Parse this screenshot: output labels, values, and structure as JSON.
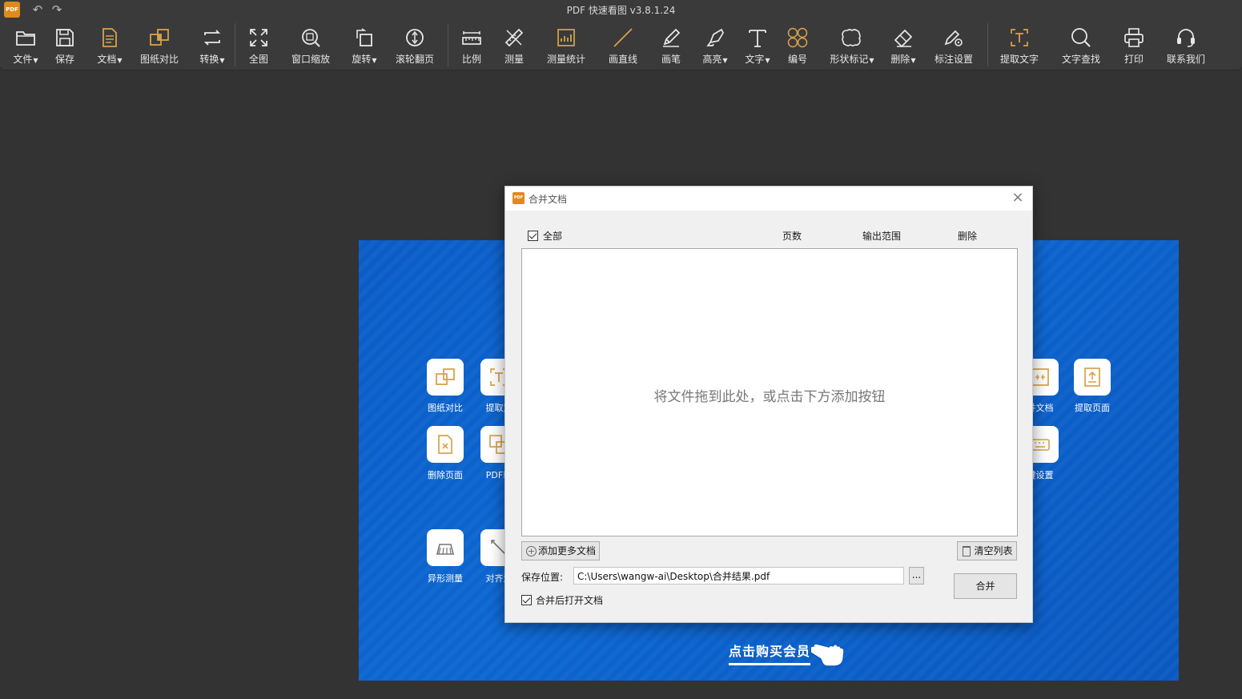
{
  "app": {
    "logo_text": "PDF",
    "title": "PDF 快速看图 v3.8.1.24"
  },
  "toolbar": {
    "items": [
      {
        "label": "文件",
        "dropdown": true,
        "icon": "folder-icon"
      },
      {
        "label": "保存",
        "dropdown": false,
        "icon": "save-icon"
      },
      {
        "label": "文档",
        "dropdown": true,
        "icon": "document-icon"
      },
      {
        "label": "图纸对比",
        "dropdown": false,
        "icon": "compare-icon"
      },
      {
        "label": "转换",
        "dropdown": true,
        "icon": "convert-icon"
      },
      {
        "label": "全图",
        "dropdown": false,
        "icon": "fit-all-icon"
      },
      {
        "label": "窗口缩放",
        "dropdown": false,
        "icon": "zoom-window-icon"
      },
      {
        "label": "旋转",
        "dropdown": true,
        "icon": "rotate-icon"
      },
      {
        "label": "滚轮翻页",
        "dropdown": false,
        "icon": "mouse-wheel-icon"
      },
      {
        "label": "比例",
        "dropdown": false,
        "icon": "scale-ruler-icon"
      },
      {
        "label": "测量",
        "dropdown": false,
        "icon": "measure-icon"
      },
      {
        "label": "测量统计",
        "dropdown": false,
        "icon": "measure-stats-icon"
      },
      {
        "label": "画直线",
        "dropdown": false,
        "icon": "line-icon"
      },
      {
        "label": "画笔",
        "dropdown": false,
        "icon": "pen-icon"
      },
      {
        "label": "高亮",
        "dropdown": true,
        "icon": "highlighter-icon"
      },
      {
        "label": "文字",
        "dropdown": true,
        "icon": "text-icon"
      },
      {
        "label": "编号",
        "dropdown": false,
        "icon": "numbering-icon"
      },
      {
        "label": "形状标记",
        "dropdown": true,
        "icon": "shape-mark-icon"
      },
      {
        "label": "删除",
        "dropdown": true,
        "icon": "eraser-icon"
      },
      {
        "label": "标注设置",
        "dropdown": false,
        "icon": "annotation-settings-icon"
      },
      {
        "label": "提取文字",
        "dropdown": false,
        "icon": "extract-text-icon"
      },
      {
        "label": "文字查找",
        "dropdown": false,
        "icon": "text-search-icon"
      },
      {
        "label": "打印",
        "dropdown": false,
        "icon": "printer-icon"
      },
      {
        "label": "联系我们",
        "dropdown": false,
        "icon": "headset-icon"
      }
    ]
  },
  "promo": {
    "features": [
      {
        "label": "图纸对比",
        "icon": "compare-icon"
      },
      {
        "label": "提取文",
        "icon": "extract-text-icon"
      },
      {
        "label": "删除页面",
        "icon": "delete-page-icon"
      },
      {
        "label": "PDF转",
        "icon": "pdf-convert-icon"
      },
      {
        "label": "异形测量",
        "icon": "irregular-measure-icon"
      },
      {
        "label": "对齐测",
        "icon": "align-measure-icon"
      },
      {
        "label": "并文档",
        "icon": "merge-doc-icon"
      },
      {
        "label": "提取页面",
        "icon": "extract-page-icon"
      },
      {
        "label": "键设置",
        "icon": "keyboard-icon"
      }
    ],
    "buy_label": "点击购买会员"
  },
  "dialog": {
    "logo_text": "PDF",
    "title": "合并文档",
    "select_all_label": "全部",
    "select_all_checked": true,
    "columns": {
      "pages": "页数",
      "range": "输出范围",
      "delete": "删除"
    },
    "drop_hint": "将文件拖到此处，或点击下方添加按钮",
    "add_more_label": "添加更多文档",
    "clear_list_label": "清空列表",
    "save_location_label": "保存位置:",
    "save_location_value": "C:\\Users\\wangw-ai\\Desktop\\合并结果.pdf",
    "browse_label": "...",
    "merge_label": "合并",
    "open_after_label": "合并后打开文档",
    "open_after_checked": true
  }
}
